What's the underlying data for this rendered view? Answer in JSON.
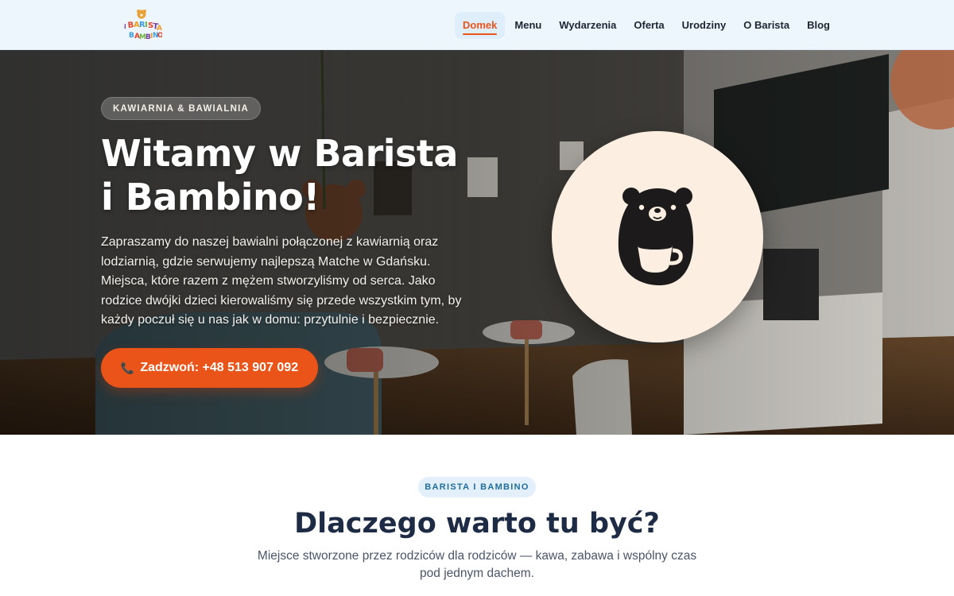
{
  "brand": {
    "logo_lines": [
      "i BARISTA",
      "BAMBINO"
    ],
    "accent_color": "#ea5418"
  },
  "nav": {
    "items": [
      {
        "label": "Domek",
        "active": true
      },
      {
        "label": "Menu",
        "active": false
      },
      {
        "label": "Wydarzenia",
        "active": false
      },
      {
        "label": "Oferta",
        "active": false
      },
      {
        "label": "Urodziny",
        "active": false
      },
      {
        "label": "O Barista",
        "active": false
      },
      {
        "label": "Blog",
        "active": false
      }
    ]
  },
  "hero": {
    "badge": "KAWIARNIA & BAWIALNIA",
    "title": "Witamy w Barista i Bambino!",
    "description": "Zapraszamy do naszej bawialni połączonej z kawiarnią oraz lodziarnią, gdzie serwujemy najlepszą Matche w Gdańsku. Miejsca, które razem z mężem stworzyliśmy od serca. Jako rodzice dwójki dzieci kierowaliśmy się przede wszystkim tym, by każdy poczuł się u nas jak w domu: przytulnie i bezpiecznie.",
    "call_button": {
      "icon": "phone-icon",
      "label": "Zadzwoń: +48 513 907 092"
    },
    "illustration_icon": "bear-with-cup-icon"
  },
  "section": {
    "badge": "BARISTA I BAMBINO",
    "title": "Dlaczego warto tu być?",
    "description": "Miejsce stworzone przez rodziców dla rodziców — kawa, zabawa i wspólny czas pod jednym dachem."
  }
}
